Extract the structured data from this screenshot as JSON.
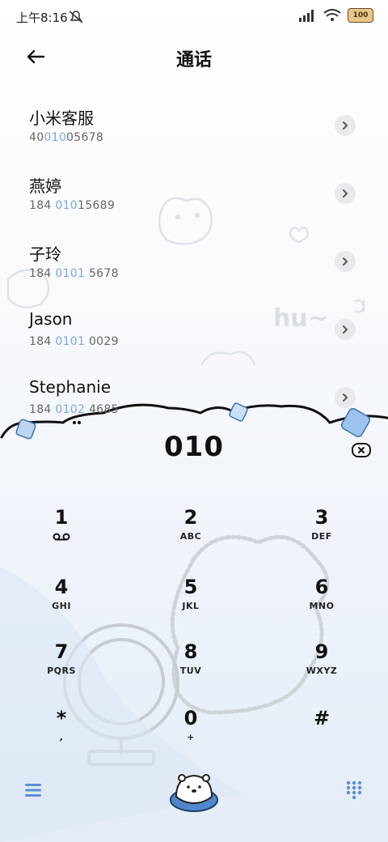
{
  "status_bar": {
    "time": "上午8:16",
    "battery": "100"
  },
  "header": {
    "title": "通话"
  },
  "contacts": [
    {
      "name": "小米客服",
      "number_pre": "40",
      "number_hl": "010",
      "number_post": "05678"
    },
    {
      "name": "燕婷",
      "number_pre": "184 ",
      "number_hl": "010",
      "number_post": "15689"
    },
    {
      "name": "子玲",
      "number_pre": "184 ",
      "number_hl": "0101",
      "number_post": " 5678"
    },
    {
      "name": "Jason",
      "number_pre": "184 ",
      "number_hl": "0101",
      "number_post": " 0029"
    },
    {
      "name": "Stephanie",
      "number_pre": "184 ",
      "number_hl": "0102",
      "number_post": " 4685"
    }
  ],
  "dialer": {
    "input_value": "010"
  },
  "keypad": [
    {
      "digit": "1",
      "letters": ""
    },
    {
      "digit": "2",
      "letters": "ABC"
    },
    {
      "digit": "3",
      "letters": "DEF"
    },
    {
      "digit": "4",
      "letters": "GHI"
    },
    {
      "digit": "5",
      "letters": "JKL"
    },
    {
      "digit": "6",
      "letters": "MNO"
    },
    {
      "digit": "7",
      "letters": "PQRS"
    },
    {
      "digit": "8",
      "letters": "TUV"
    },
    {
      "digit": "9",
      "letters": "WXYZ"
    },
    {
      "digit": "*",
      "letters": ","
    },
    {
      "digit": "0",
      "letters": "+"
    },
    {
      "digit": "#",
      "letters": ""
    }
  ],
  "decor_text": "hu~",
  "colors": {
    "highlight": "#7aa7dd",
    "accent_blue": "#5b8fd6"
  }
}
